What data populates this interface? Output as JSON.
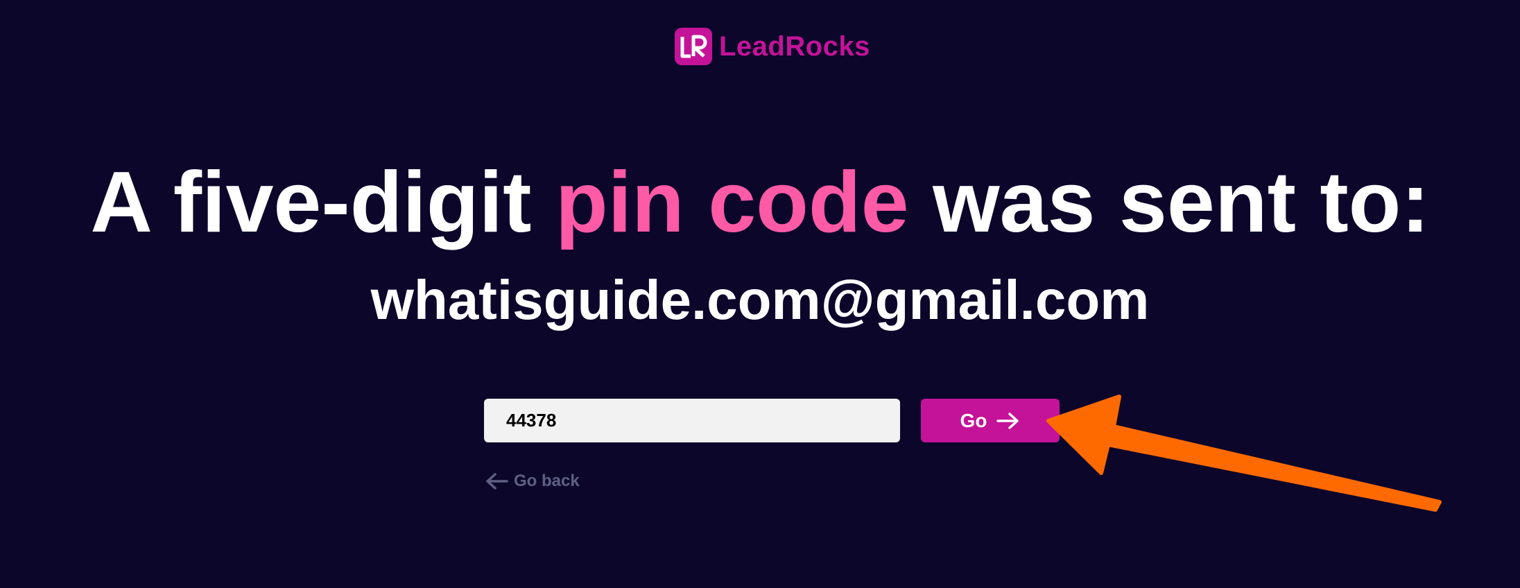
{
  "brand": {
    "logo_text": "LR",
    "name": "LeadRocks",
    "color": "#c41398"
  },
  "headline": {
    "before": "A five-digit ",
    "accent": "pin code",
    "after": " was sent to:",
    "accent_color": "#ff5aa6"
  },
  "email": "whatisguide.com@gmail.com",
  "pin_form": {
    "value": "44378",
    "submit_label": "Go",
    "submit_icon": "arrow-right-icon"
  },
  "go_back": {
    "label": "Go back",
    "icon": "arrow-left-icon"
  },
  "colors": {
    "background": "#0c062b",
    "button": "#c41398",
    "annotation_arrow": "#ff6a00"
  }
}
